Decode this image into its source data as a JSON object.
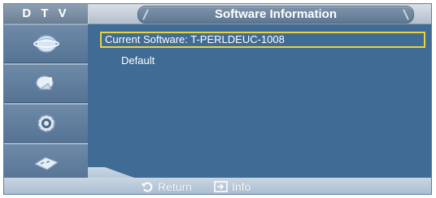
{
  "osd": {
    "source_label": "D T V",
    "title": "Software Information"
  },
  "sidebar": {
    "items": [
      {
        "icon": "globe-icon",
        "label": ""
      },
      {
        "icon": "satellite-dish-icon",
        "label": ""
      },
      {
        "icon": "settings-gear-icon",
        "label": ""
      },
      {
        "icon": "input-remote-icon",
        "label": ""
      }
    ]
  },
  "content": {
    "current_software": "Current Software: T-PERLDEUC-1008",
    "default_label": "Default"
  },
  "footer": {
    "return_label": "Return",
    "info_label": "Info"
  },
  "colors": {
    "panel": "#3f6b94",
    "highlight_border": "#e8d43a",
    "footer": "#b8c8d8"
  }
}
